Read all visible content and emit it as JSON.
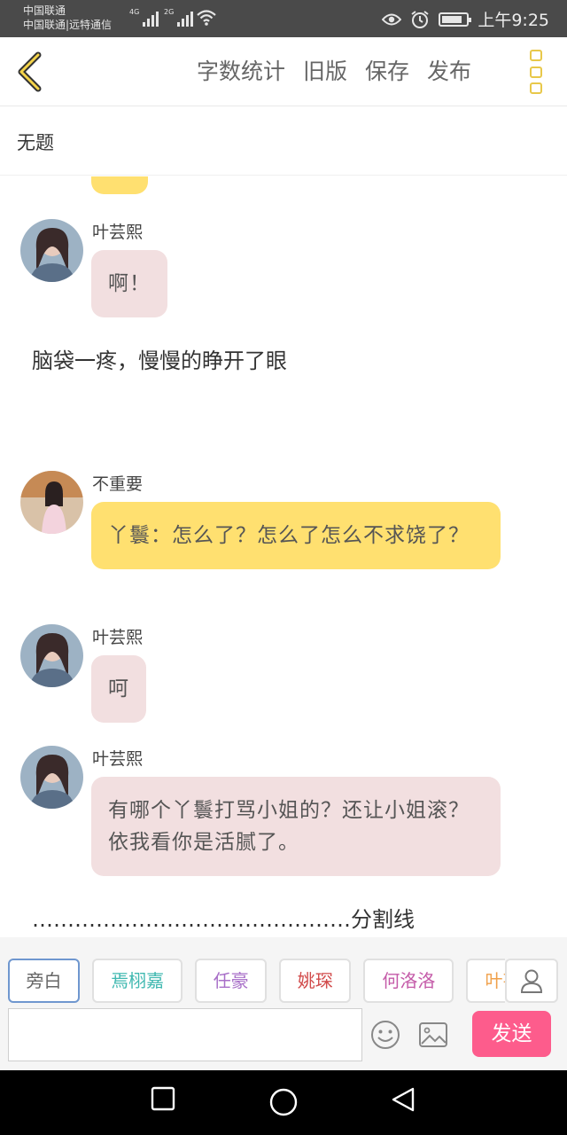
{
  "status_bar": {
    "carrier_line1": "中国联通",
    "carrier_line2": "中国联通|远特通信",
    "sig1_label": "4G",
    "sig2_label": "2G",
    "time": "上午9:25",
    "battery_level": 0.85,
    "icons": [
      "signal-4g-icon",
      "signal-2g-icon",
      "wifi-icon",
      "eye-icon",
      "alarm-icon",
      "battery-icon"
    ]
  },
  "toolbar": {
    "back_icon": "chevron-left-icon",
    "word_count": "字数统计",
    "old_version": "旧版",
    "save": "保存",
    "publish": "发布",
    "more_icon": "three-boxes-menu-icon"
  },
  "document": {
    "title": "无题"
  },
  "messages": [
    {
      "type": "dialogue",
      "name": "叶芸熙",
      "text": "啊！",
      "color": "#f2dfe0"
    },
    {
      "type": "narration",
      "text": "脑袋一疼，慢慢的睁开了眼"
    },
    {
      "type": "dialogue",
      "name": "不重要",
      "text": "丫鬟：怎么了？怎么了怎么不求饶了？",
      "color": "#ffe070"
    },
    {
      "type": "dialogue",
      "name": "叶芸熙",
      "text": "呵",
      "color": "#f2dfe0"
    },
    {
      "type": "dialogue",
      "name": "叶芸熙",
      "text": "有哪个丫鬟打骂小姐的？还让小姐滚？依我看你是活腻了。",
      "color": "#f2dfe0"
    },
    {
      "type": "narration",
      "text": "………………………………………分割线"
    }
  ],
  "roles": [
    {
      "label": "旁白",
      "color": "#666666"
    },
    {
      "label": "焉栩嘉",
      "color": "#3fb8b0"
    },
    {
      "label": "任豪",
      "color": "#a86fc8"
    },
    {
      "label": "姚琛",
      "color": "#d14a4a"
    },
    {
      "label": "何洛洛",
      "color": "#c45aa8"
    },
    {
      "label": "叶芸熙",
      "color": "#f0a04a"
    }
  ],
  "composer": {
    "input_value": "",
    "send_label": "发送",
    "send_color": "#fd5c8c",
    "icons": [
      "user-icon",
      "emoji-icon",
      "image-icon"
    ]
  },
  "nav_bar": {
    "icons": [
      "square-recents-icon",
      "circle-home-icon",
      "triangle-back-icon"
    ]
  }
}
